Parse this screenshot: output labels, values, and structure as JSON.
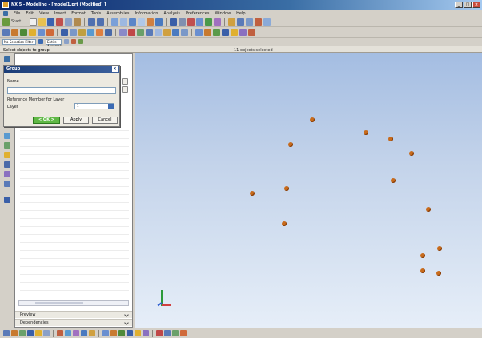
{
  "window": {
    "title": "NX 5 - Modeling - [model1.prt (Modified) ]",
    "min": "_",
    "max": "□",
    "close": "×"
  },
  "menu": [
    "File",
    "Edit",
    "View",
    "Insert",
    "Format",
    "Tools",
    "Assemblies",
    "Information",
    "Analysis",
    "Preferences",
    "Window",
    "Help"
  ],
  "toolbar1": {
    "start_label": "Start"
  },
  "selection": {
    "filter_value": "No Selection Filter",
    "scope_value": "Entire Assembly"
  },
  "prompt": {
    "cue": "Select objects to group",
    "status": "11 objects selected"
  },
  "dialog": {
    "title": "Group",
    "name_label": "Name",
    "name_value": "",
    "option_label": "Reference Member for Layer",
    "layer_label": "Layer",
    "layer_value": "1",
    "ok_label": "< OK >",
    "apply_label": "Apply",
    "cancel_label": "Cancel"
  },
  "navigator": {
    "sections": [
      "Preview",
      "Dependencies"
    ]
  },
  "colors": {
    "accent": "#3a6ea5",
    "point": "#c86b1c",
    "ok_button": "#5fb845"
  },
  "icons": [
    "file-new-icon",
    "open-icon",
    "save-icon",
    "cut-icon",
    "copy-icon",
    "paste-icon",
    "undo-icon",
    "redo-icon",
    "fit-view-icon",
    "zoom-icon",
    "rotate-icon",
    "point-icon",
    "line-icon",
    "arc-icon",
    "sketch-icon",
    "extrude-icon",
    "measure-icon"
  ]
}
